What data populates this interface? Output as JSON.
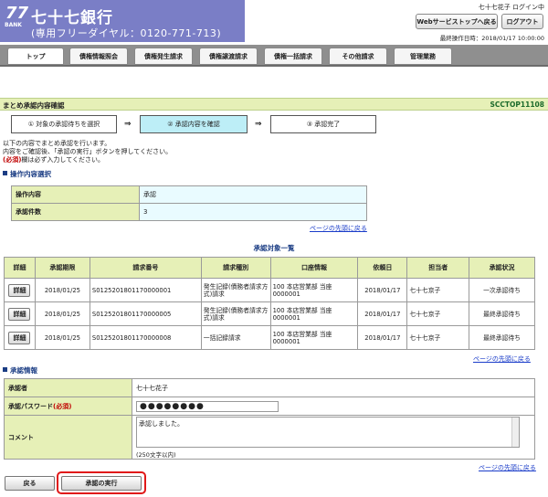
{
  "header": {
    "logo_num": "77",
    "logo_bank": "BANK",
    "bank_name": "七十七銀行",
    "freedial": "(専用フリーダイヤル：0120-771-713)",
    "user_status": "七十七花子 ログイン中",
    "websvc_button": "Webサービストップへ戻る",
    "logout_button": "ログアウト",
    "last_operation": "最終操作日時：2018/01/17 10:00:00"
  },
  "nav": {
    "tabs": [
      "トップ",
      "債権情報照会",
      "債権発生請求",
      "債権譲渡請求",
      "債権一括請求",
      "その他請求",
      "管理業務"
    ]
  },
  "page": {
    "title": "まとめ承認内容確認",
    "screen_id": "SCCTOP11108"
  },
  "steps": {
    "step1": "① 対象の承認待ちを選択",
    "step2": "② 承認内容を確認",
    "step3": "③ 承認完了",
    "arrow": "⇒"
  },
  "instructions": {
    "line1": "以下の内容でまとめ承認を行います。",
    "line2": "内容をご確認後、「承認の実行」ボタンを押してください。",
    "line3_req": "(必須)",
    "line3_rest": "欄は必ず入力してください。"
  },
  "operation": {
    "section_title": "操作内容選択",
    "rows": [
      {
        "label": "操作内容",
        "value": "承認"
      },
      {
        "label": "承認件数",
        "value": "3"
      }
    ]
  },
  "page_top_link": "ページの先頭に戻る",
  "list": {
    "title": "承認対象一覧",
    "headers": [
      "詳細",
      "承認期限",
      "請求番号",
      "請求種別",
      "口座情報",
      "依頼日",
      "担当者",
      "承認状況"
    ],
    "detail_label": "詳細",
    "rows": [
      {
        "deadline": "2018/01/25",
        "request_no": "S0125201801170000001",
        "type": "発生記録(債務者請求方式)請求",
        "account": "100 本店営業部 当座 0000001",
        "date": "2018/01/17",
        "person": "七十七京子",
        "status": "一次承認待ち"
      },
      {
        "deadline": "2018/01/25",
        "request_no": "S0125201801170000005",
        "type": "発生記録(債務者請求方式)請求",
        "account": "100 本店営業部 当座 0000001",
        "date": "2018/01/17",
        "person": "七十七京子",
        "status": "最終承認待ち"
      },
      {
        "deadline": "2018/01/25",
        "request_no": "S0125201801170000008",
        "type": "一括記録請求",
        "account": "100 本店営業部 当座 0000001",
        "date": "2018/01/17",
        "person": "七十七京子",
        "status": "最終承認待ち"
      }
    ]
  },
  "approval": {
    "section_title": "承認情報",
    "approver_label": "承認者",
    "approver_value": "七十七花子",
    "password_label": "承認パスワード",
    "password_req": "(必須)",
    "password_value": "●●●●●●●●",
    "comment_label": "コメント",
    "comment_value": "承認しました。",
    "comment_hint": "(250文字以内)"
  },
  "buttons": {
    "back": "戻る",
    "execute": "承認の実行"
  }
}
